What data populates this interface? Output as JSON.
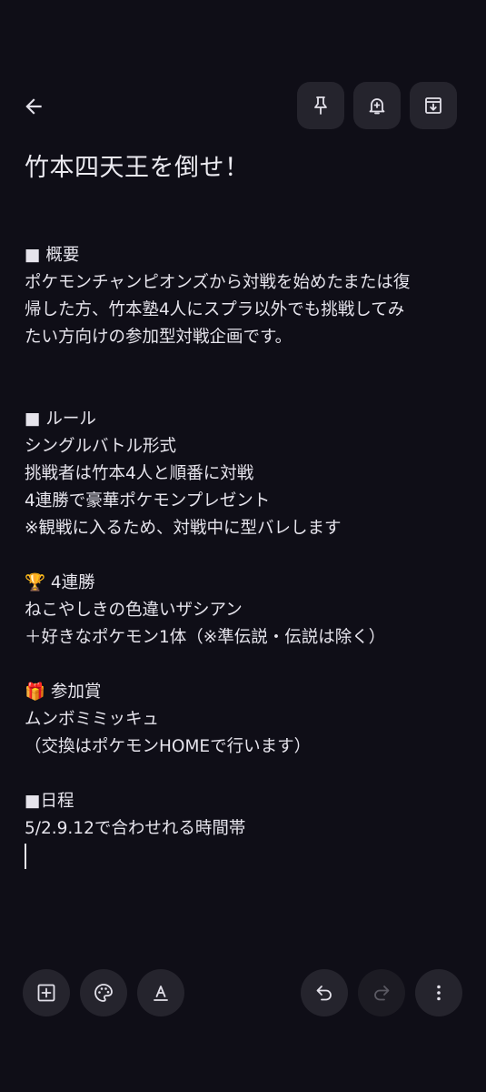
{
  "note": {
    "title": "竹本四天王を倒せ！",
    "lines": [
      "■ 概要",
      "ポケモンチャンピオンズから対戦を始めたまたは復",
      "帰した方、竹本塾4人にスプラ以外でも挑戦してみ",
      "たい方向けの参加型対戦企画です。",
      "",
      "",
      "■ ルール",
      "シングルバトル形式",
      "挑戦者は竹本4人と順番に対戦",
      "4連勝で豪華ポケモンプレゼント",
      "※観戦に入るため、対戦中に型バレします",
      "",
      "🏆 4連勝",
      "ねこやしきの色違いザシアン",
      "＋好きなポケモン1体（※準伝説・伝説は除く）",
      "",
      "🎁 参加賞",
      "ムンボミミッキュ",
      "（交換はポケモンHOMEで行います）",
      "",
      "■日程",
      "5/2.9.12で合わせれる時間帯"
    ]
  },
  "icons": {
    "back": "arrow-back-icon",
    "pin": "pin-icon",
    "reminder": "bell-plus-icon",
    "archive": "archive-icon",
    "add": "add-box-icon",
    "palette": "palette-icon",
    "text_format": "text-format-icon",
    "undo": "undo-icon",
    "redo": "redo-icon",
    "more": "more-vert-icon"
  },
  "colors": {
    "background": "#0f0e17",
    "button": "#25242d",
    "text": "#e6e4ec",
    "icon": "#e3e1ea",
    "icon_disabled": "#5a5962"
  }
}
